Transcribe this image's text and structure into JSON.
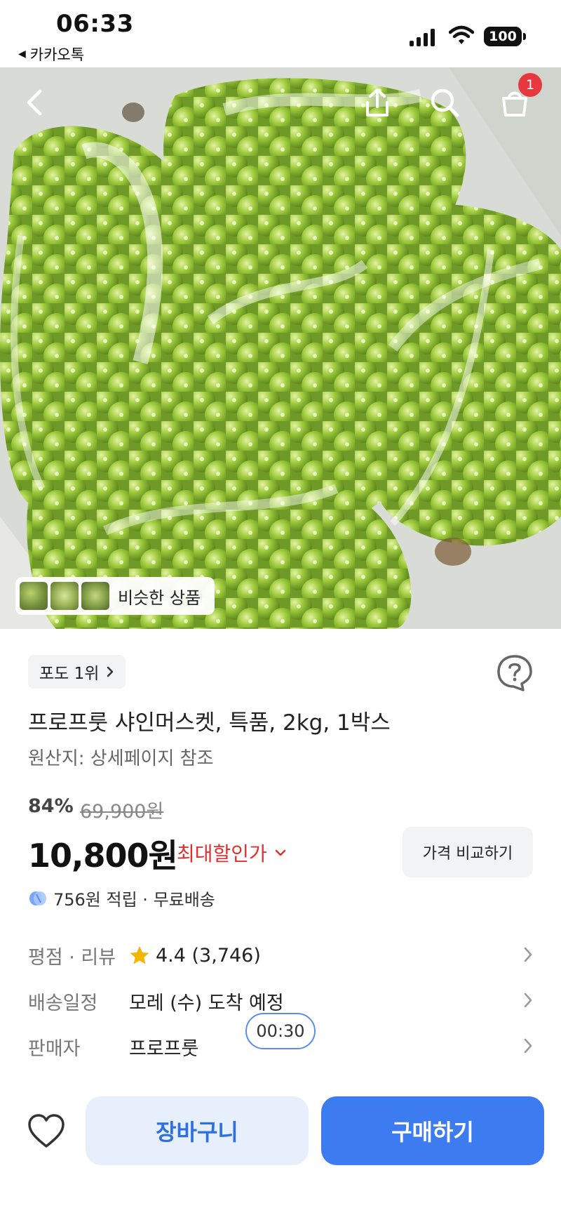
{
  "status_bar": {
    "time": "06:33",
    "back_app": "카카오톡",
    "battery": "100"
  },
  "hero": {
    "cart_count": "1",
    "similar_label": "비슷한 상품"
  },
  "product": {
    "rank_badge": "포도 1위",
    "title": "프로프룻 샤인머스켓, 특품, 2kg, 1박스",
    "origin": "원산지: 상세페이지 참조",
    "discount_rate": "84%",
    "original_price": "69,900원",
    "price": "10,800원",
    "max_discount_label": "최대할인가",
    "compare_button": "가격 비교하기",
    "points": "756원 적립 · 무료배송"
  },
  "details": {
    "rating_label": "평점 · 리뷰",
    "rating_value": "4.4 (3,746)",
    "delivery_label": "배송일정",
    "delivery_value": "모레 (수) 도착 예정",
    "seller_label": "판매자",
    "seller_value": "프로프룻"
  },
  "timer": "00:30",
  "bottom_bar": {
    "cart_button": "장바구니",
    "buy_button": "구매하기"
  },
  "colors": {
    "accent_blue": "#3d7cf0",
    "discount_red": "#e0302f",
    "badge_red": "#e5393f",
    "star_yellow": "#f5b400"
  }
}
